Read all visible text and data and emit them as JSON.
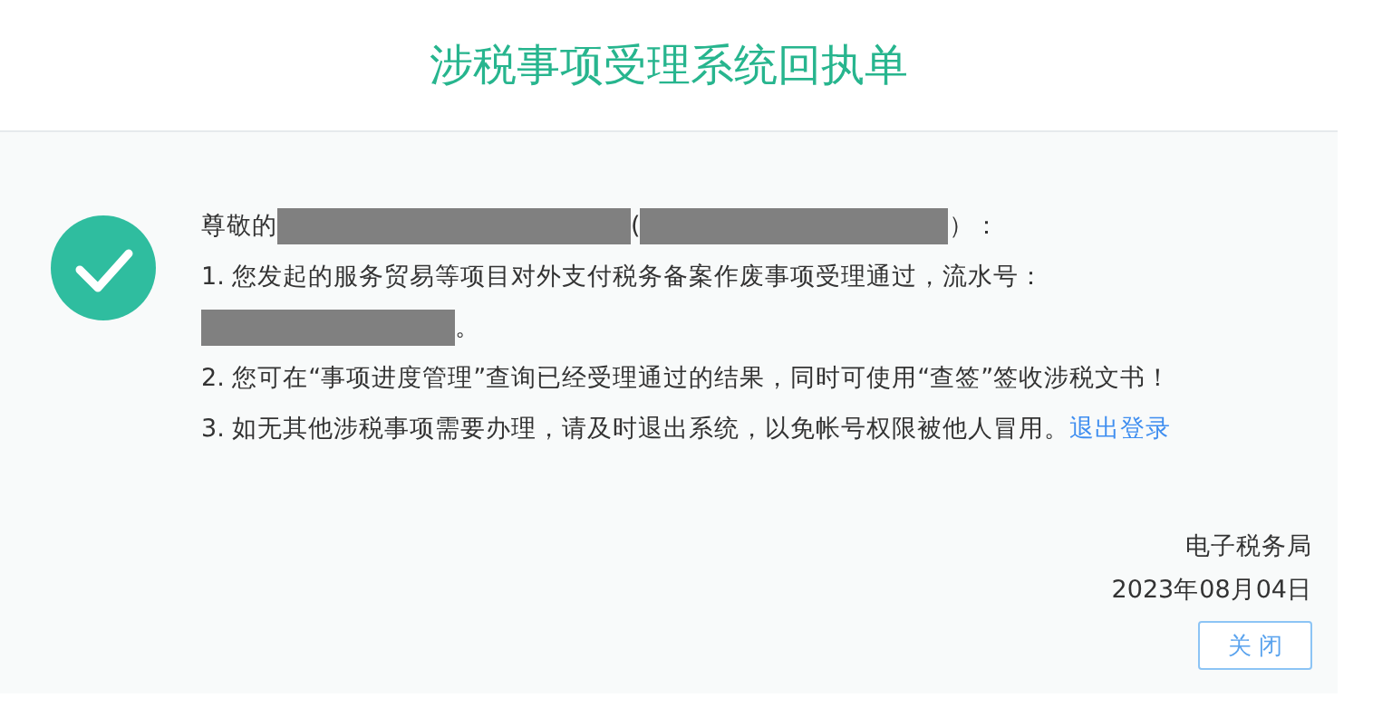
{
  "title": "涉税事项受理系统回执单",
  "lines": [
    [
      {
        "kind": "text",
        "text": "尊敬的"
      },
      {
        "kind": "redacted"
      },
      {
        "kind": "text",
        "text": "("
      },
      {
        "kind": "redacted"
      },
      {
        "kind": "text",
        "text": "）："
      }
    ],
    [
      {
        "kind": "text",
        "text": "1. 您发起的服务贸易等项目对外支付税务备案作废事项受理通过，流水号："
      }
    ],
    [
      {
        "kind": "redacted"
      },
      {
        "kind": "text",
        "text": "。"
      }
    ],
    [
      {
        "kind": "text",
        "text": "2. 您可在“事项进度管理”查询已经受理通过的结果，同时可使用“查签”签收涉税文书！"
      }
    ],
    [
      {
        "kind": "text",
        "text": "3. 如无其他涉税事项需要办理，请及时退出系统，以免帐号权限被他人冒用。"
      },
      {
        "kind": "link",
        "text": "退出登录"
      }
    ]
  ],
  "signature": "电子税务局",
  "date": "2023年08月04日",
  "close_button": "关 闭"
}
